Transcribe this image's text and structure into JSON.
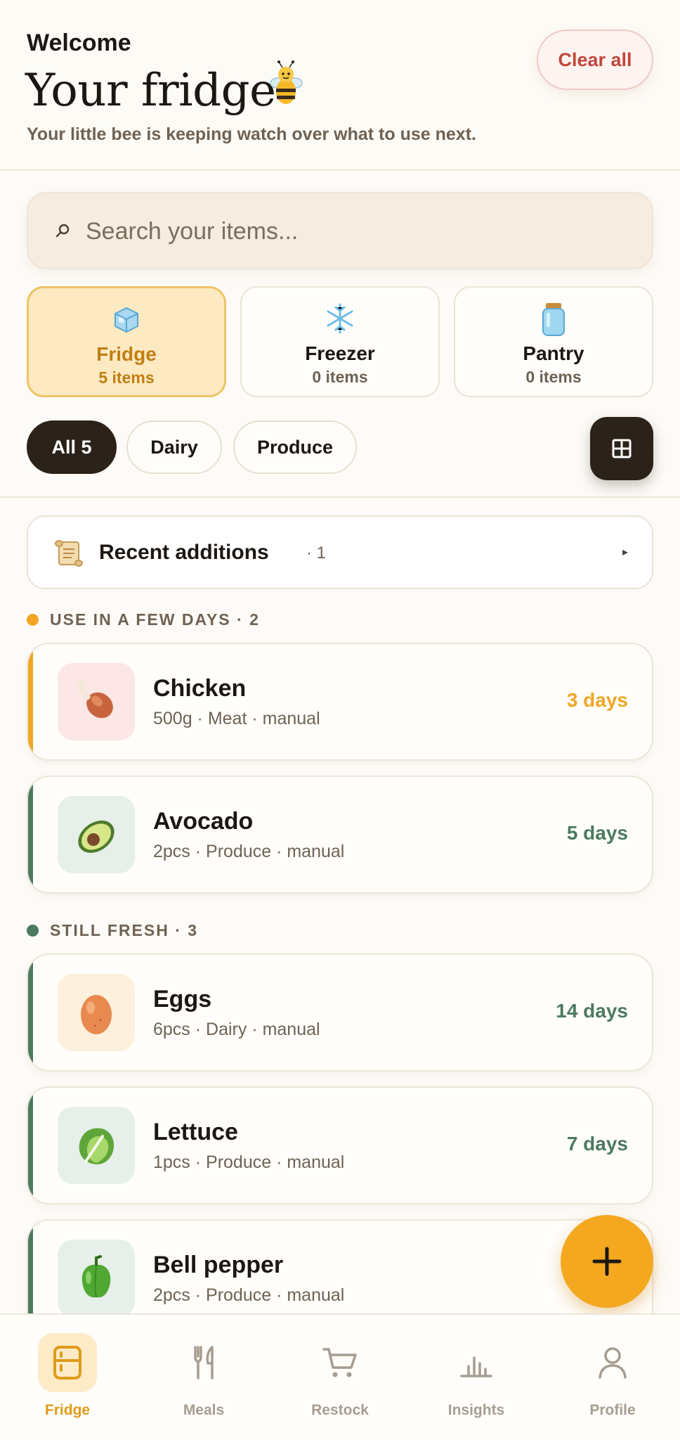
{
  "header": {
    "welcome": "Welcome",
    "title": "Your fridge",
    "subtitle": "Your little bee is keeping watch over what to use next.",
    "clear_all": "Clear all"
  },
  "search": {
    "placeholder": "Search your items...",
    "value": ""
  },
  "locations": [
    {
      "name": "Fridge",
      "count": "5 items",
      "icon": "ice-cube-icon",
      "active": true
    },
    {
      "name": "Freezer",
      "count": "0 items",
      "icon": "snowflake-icon",
      "active": false
    },
    {
      "name": "Pantry",
      "count": "0 items",
      "icon": "jar-icon",
      "active": false
    }
  ],
  "filters": [
    {
      "label": "All 5",
      "active": true
    },
    {
      "label": "Dairy",
      "active": false
    },
    {
      "label": "Produce",
      "active": false
    }
  ],
  "recent": {
    "label": "Recent additions",
    "count": "· 1",
    "arrow": "▸"
  },
  "sections": [
    {
      "label": "USE IN A FEW DAYS · 2",
      "color": "#f0a623"
    },
    {
      "label": "STILL FRESH · 3",
      "color": "#4c7a5f"
    }
  ],
  "items": [
    {
      "name": "Chicken",
      "meta": "500g · Meat · manual",
      "days": "3 days",
      "color": "#f0a623",
      "icon": "drumstick-icon"
    },
    {
      "name": "Avocado",
      "meta": "2pcs · Produce · manual",
      "days": "5 days",
      "color": "#4c7a5f",
      "icon": "avocado-icon"
    },
    {
      "name": "Eggs",
      "meta": "6pcs · Dairy · manual",
      "days": "14 days",
      "color": "#4c7a5f",
      "icon": "egg-icon"
    },
    {
      "name": "Lettuce",
      "meta": "1pcs · Produce · manual",
      "days": "7 days",
      "color": "#4c7a5f",
      "icon": "lettuce-icon"
    },
    {
      "name": "Bell pepper",
      "meta": "2pcs · Produce · manual",
      "days": "",
      "color": "#4c7a5f",
      "icon": "bell-pepper-icon"
    }
  ],
  "nav": [
    {
      "label": "Fridge",
      "icon": "fridge-icon",
      "active": true
    },
    {
      "label": "Meals",
      "icon": "utensils-icon",
      "active": false
    },
    {
      "label": "Restock",
      "icon": "cart-icon",
      "active": false
    },
    {
      "label": "Insights",
      "icon": "bar-chart-icon",
      "active": false
    },
    {
      "label": "Profile",
      "icon": "user-icon",
      "active": false
    }
  ],
  "colors": {
    "accent": "#f3a81f",
    "warning": "#f0a623",
    "fresh": "#4c7a5f",
    "danger": "#c2463b",
    "dark": "#2b2219"
  }
}
